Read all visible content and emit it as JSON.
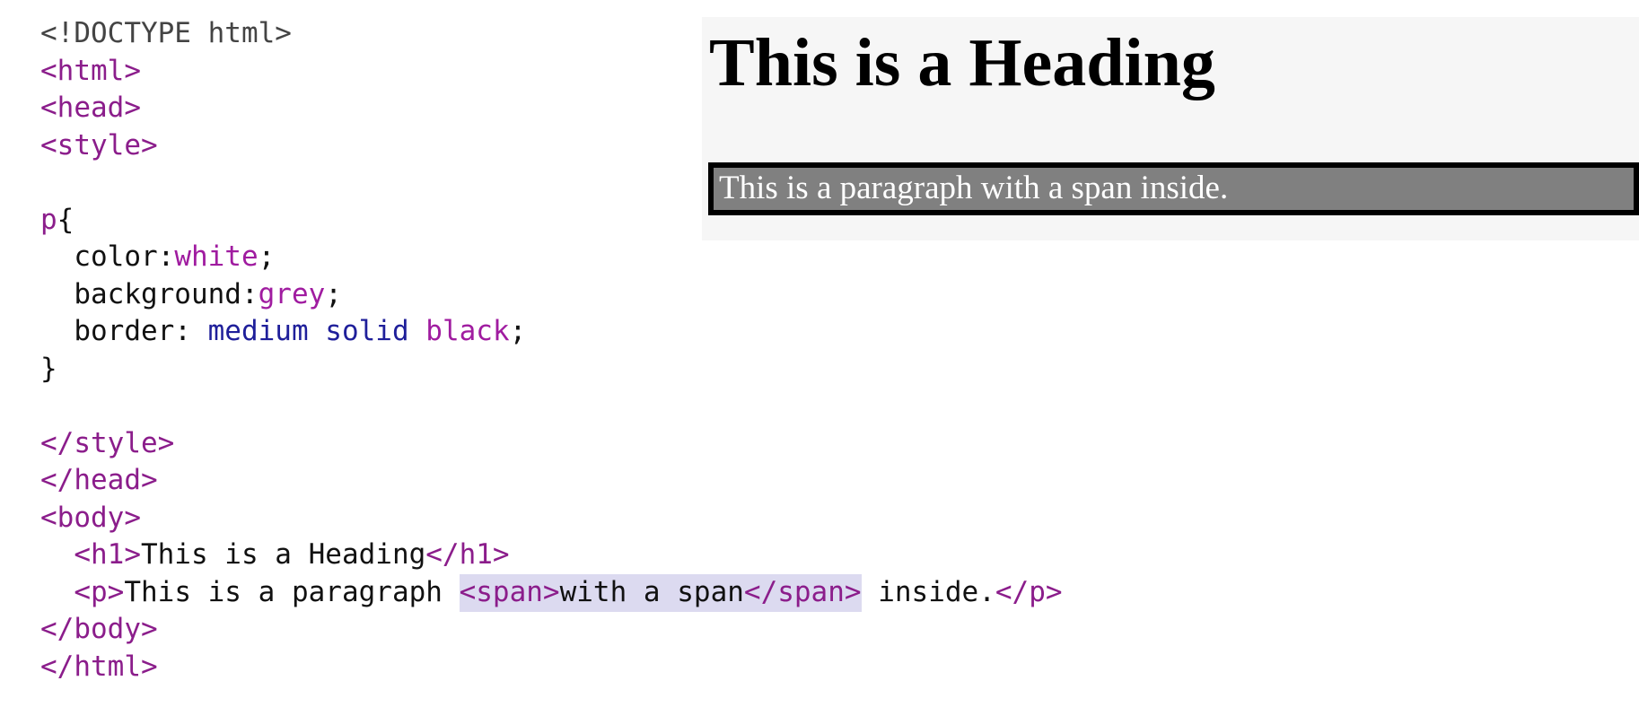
{
  "editor": {
    "line_doctype": "<!DOCTYPE html>",
    "line_html_open": "<html>",
    "line_head_open": "<head>",
    "line_style_open": "<style>",
    "css": {
      "selector": "p",
      "open_brace": "{",
      "close_brace": "}",
      "rules": {
        "color_prop": "color:",
        "color_value": "white",
        "background_prop": "background:",
        "background_value": "grey",
        "border_prop": "border: ",
        "border_width": "medium",
        "border_style": "solid",
        "border_color": "black",
        "semicolon": ";"
      }
    },
    "line_style_close": "</style>",
    "line_head_close": "</head>",
    "line_body_open": "<body>",
    "h1_line": {
      "open_tag": "<h1>",
      "text": "This is a Heading",
      "close_tag": "</h1>"
    },
    "p_line": {
      "open_tag": "<p>",
      "text_before": "This is a paragraph ",
      "span_open": "<span>",
      "span_text": "with a span",
      "span_close": "</span>",
      "text_after": " inside.",
      "close_tag": "</p>"
    },
    "line_body_close": "</body>",
    "line_html_close": "</html>"
  },
  "result": {
    "heading": "This is a Heading",
    "paragraph": "This is a paragraph with a span inside."
  },
  "colors": {
    "tag": "#8b1d8b",
    "keyword": "#1f1f9a",
    "highlight": "#dcdaf0",
    "result_background": "#f6f6f6",
    "paragraph_background": "#808080"
  }
}
